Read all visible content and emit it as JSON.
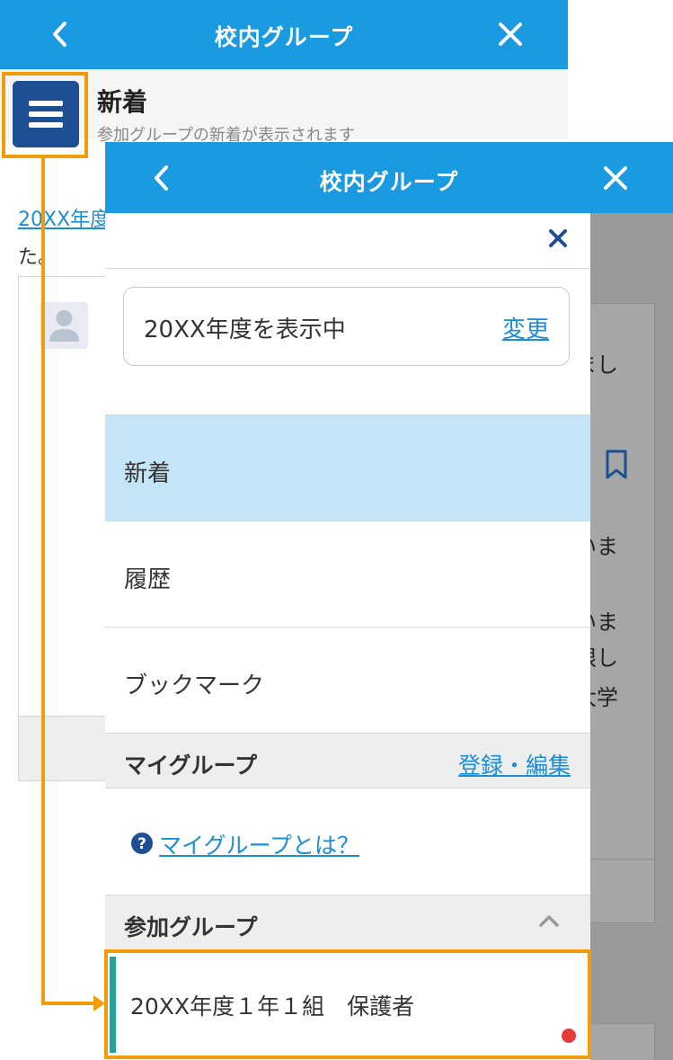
{
  "background": {
    "header": {
      "title": "校内グループ"
    },
    "subheader": {
      "title": "新着",
      "description": "参加グループの新着が表示されます"
    },
    "content": {
      "link_text": "20XX年度",
      "text": "た。"
    },
    "dimmed_text": [
      "まし",
      "いま",
      "いま",
      "限し",
      "大学"
    ]
  },
  "overlay": {
    "header": {
      "title": "校内グループ"
    },
    "year_selector": {
      "text": "20XX年度を表示中",
      "change_label": "変更"
    },
    "nav": [
      {
        "label": "新着",
        "active": true
      },
      {
        "label": "履歴",
        "active": false
      },
      {
        "label": "ブックマーク",
        "active": false
      }
    ],
    "my_group": {
      "label": "マイグループ",
      "action_label": "登録・編集",
      "help_link": "マイグループとは？"
    },
    "joined_groups": {
      "label": "参加グループ",
      "items": [
        {
          "name": "20XX年度１年１組　保護者",
          "has_unread": true
        }
      ]
    }
  },
  "colors": {
    "header_blue": "#1a9ae0",
    "menu_button": "#1f4f93",
    "highlight_orange": "#f29b0b",
    "active_nav": "#c3e5f6",
    "link_blue": "#1a8fd6",
    "group_accent": "#2aa198",
    "unread_dot": "#e83a3a"
  },
  "icons": [
    "chevron-left-icon",
    "close-icon",
    "hamburger-menu-icon",
    "user-icon",
    "bookmark-icon",
    "help-circle-icon",
    "chevron-up-icon"
  ]
}
